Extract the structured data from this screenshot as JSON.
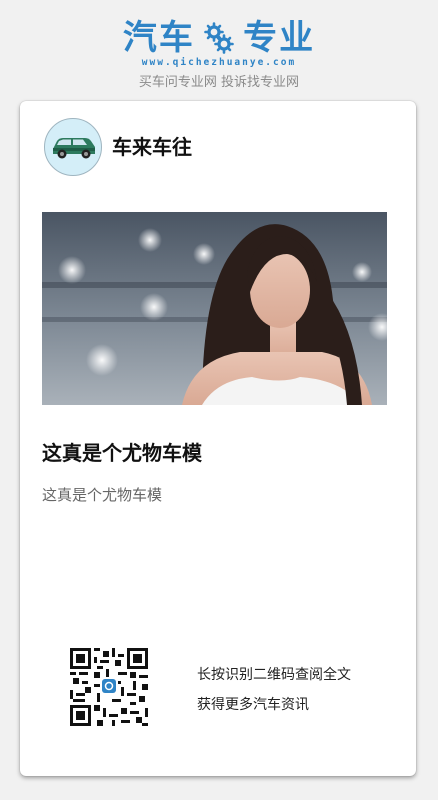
{
  "brand": {
    "logo_left": "汽车",
    "logo_right": "专业",
    "domain": "www.qichezhuanye.com",
    "slogan": "买车问专业网 投诉找专业网",
    "color": "#2f84c6"
  },
  "card": {
    "author_name": "车来车往",
    "avatar_icon": "car-icon",
    "article_title": "这真是个尤物车模",
    "article_summary": "这真是个尤物车模",
    "qr_line1": "长按识别二维码查阅全文",
    "qr_line2": "获得更多汽车资讯",
    "qr_icon": "qr-code-icon"
  }
}
